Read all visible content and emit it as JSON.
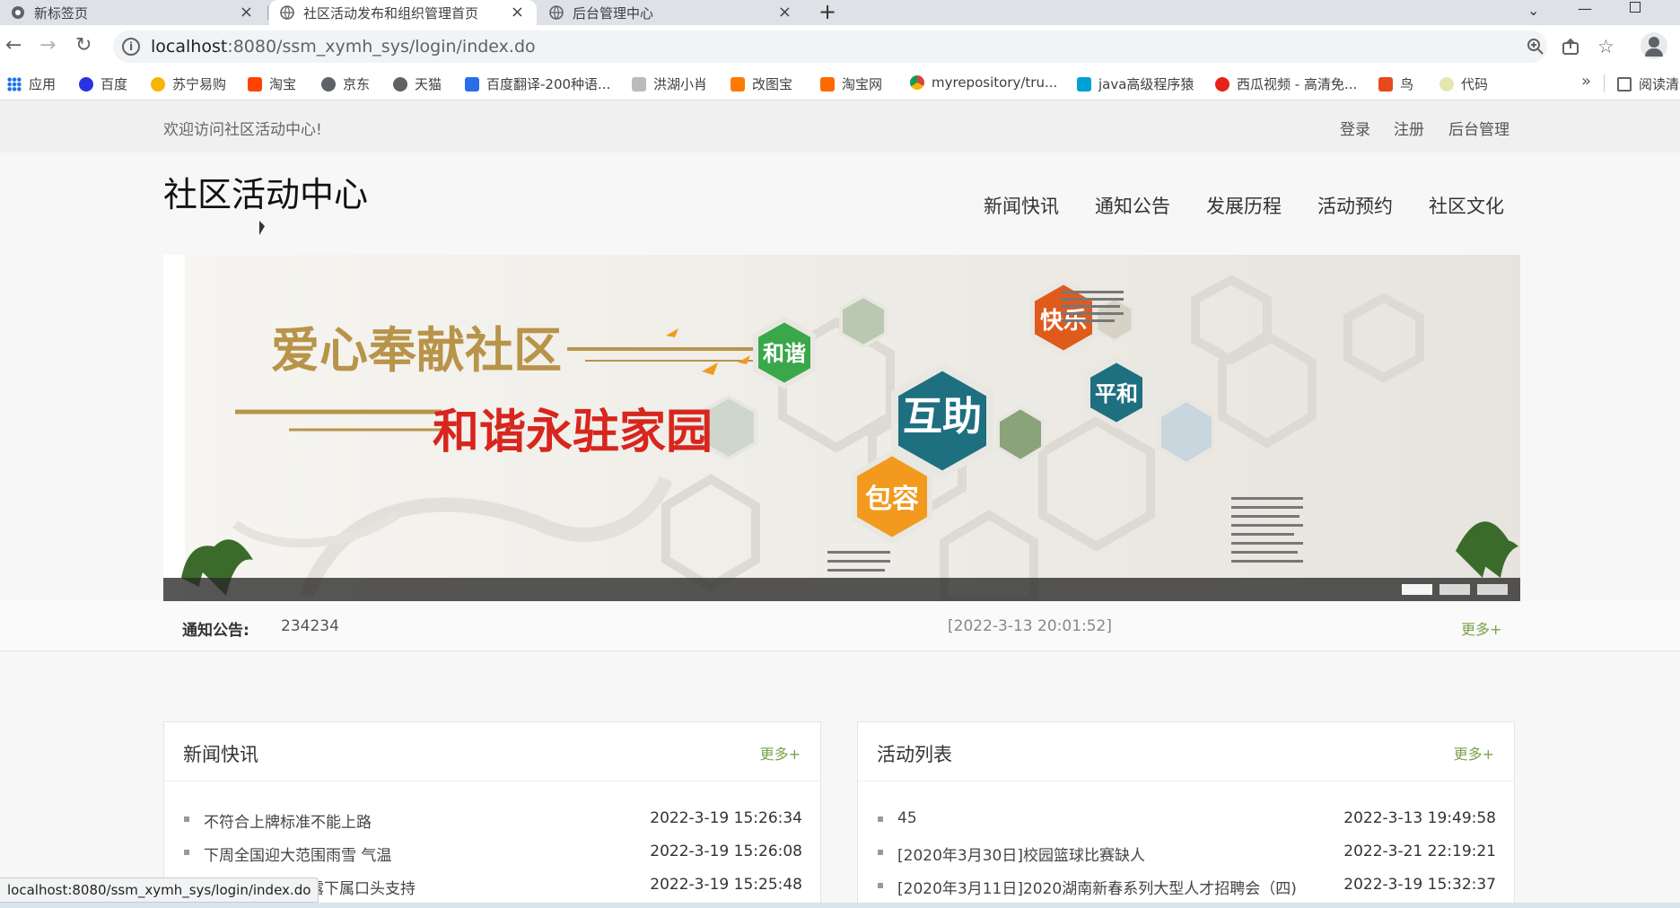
{
  "browser": {
    "tabs": [
      {
        "title": "新标签页",
        "active": false
      },
      {
        "title": "社区活动发布和组织管理首页",
        "active": true
      },
      {
        "title": "后台管理中心",
        "active": false
      }
    ],
    "new_tab_glyph": "+",
    "url_host": "localhost",
    "url_rest": ":8080/ssm_xymh_sys/login/index.do",
    "status_url": "localhost:8080/ssm_xymh_sys/login/index.do",
    "bookmarks": [
      {
        "label": "应用",
        "icon": "apps-grid-icon",
        "color": "#1a73e8"
      },
      {
        "label": "百度",
        "icon": "baidu-paw-icon",
        "color": "#2932e1"
      },
      {
        "label": "苏宁易购",
        "icon": "suning-icon",
        "color": "#f7b500"
      },
      {
        "label": "淘宝",
        "icon": "taobao-icon",
        "color": "#ff4400"
      },
      {
        "label": "京东",
        "icon": "globe-icon",
        "color": "#5f6368"
      },
      {
        "label": "天猫",
        "icon": "globe-icon",
        "color": "#5f6368"
      },
      {
        "label": "百度翻译-200种语...",
        "icon": "translate-icon",
        "color": "#2b6de8"
      },
      {
        "label": "洪湖小肖",
        "icon": "bird-icon",
        "color": "#888888"
      },
      {
        "label": "改图宝",
        "icon": "gaitubao-icon",
        "color": "#ff7a00"
      },
      {
        "label": "淘宝网",
        "icon": "taobao-icon",
        "color": "#ff6a00"
      },
      {
        "label": "myrepository/tru...",
        "icon": "chrome-icon",
        "color": "#db4437"
      },
      {
        "label": "java高级程序猿",
        "icon": "bilibili-icon",
        "color": "#00a1d6"
      },
      {
        "label": "西瓜视频 - 高清免...",
        "icon": "xigua-icon",
        "color": "#e62117"
      },
      {
        "label": "鸟",
        "icon": "bird-icon",
        "color": "#e8491d"
      },
      {
        "label": "代码",
        "icon": "code-icon",
        "color": "#c8c866"
      }
    ],
    "bookmarks_more": "»",
    "reading_list": "阅读清"
  },
  "site": {
    "welcome": "欢迎访问社区活动中心!",
    "top_links": [
      "登录",
      "注册",
      "后台管理"
    ],
    "title": "社区活动中心",
    "nav": [
      "新闻快讯",
      "通知公告",
      "发展历程",
      "活动预约",
      "社区文化"
    ],
    "banner": {
      "heading_top": "爱心奉献社区",
      "heading_bottom": "和谐永驻家园",
      "hex_words": [
        "和谐",
        "互助",
        "包容",
        "快乐",
        "平和"
      ],
      "colors": {
        "green": "#3aa84a",
        "teal": "#1e6f80",
        "orange": "#f39a1e",
        "red_orange": "#e05a1c",
        "title_red": "#d7261e",
        "gold": "#b8944a"
      }
    },
    "notice": {
      "label": "通知公告:",
      "text": "234234",
      "time": "[2022-3-13 20:01:52]",
      "more": "更多+"
    },
    "news": {
      "title": "新闻快讯",
      "more": "更多+",
      "items": [
        {
          "text": "不符合上牌标准不能上路",
          "time": "2022-3-19 15:26:34"
        },
        {
          "text": "下周全国迎大范围雨雪 气温",
          "time": "2022-3-19 15:26:08"
        },
        {
          "text": "暴露下属口头支持",
          "time": "2022-3-19 15:25:48"
        }
      ]
    },
    "activities": {
      "title": "活动列表",
      "more": "更多+",
      "items": [
        {
          "text": "45",
          "time": "2022-3-13 19:49:58"
        },
        {
          "text": "[2020年3月30日]校园篮球比赛缺人",
          "time": "2022-3-21 22:19:21"
        },
        {
          "text": "[2020年3月11日]2020湖南新春系列大型人才招聘会（四)",
          "time": "2022-3-19 15:32:37"
        }
      ]
    }
  }
}
